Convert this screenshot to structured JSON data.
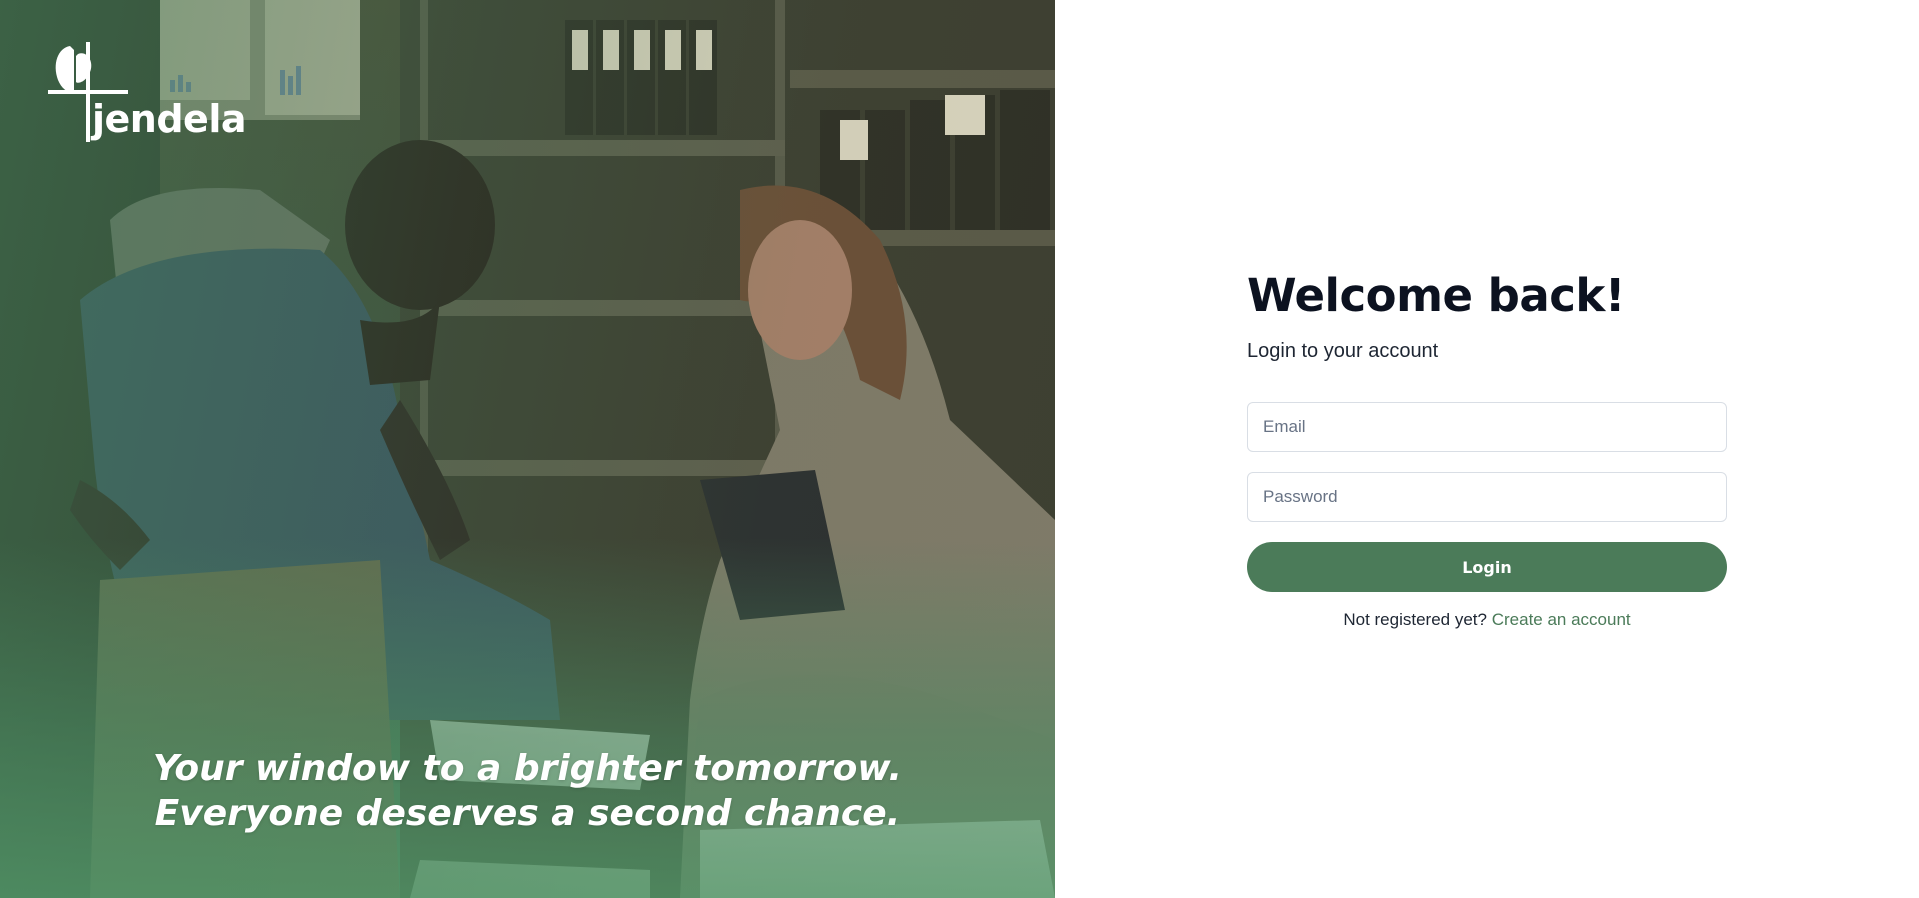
{
  "brand": {
    "name": "jendela",
    "tagline": "Your window to a brighter tomorrow. Everyone deserves a second chance.",
    "accent_color": "#4b7b59"
  },
  "login": {
    "title": "Welcome back!",
    "subtitle": "Login to your account",
    "email_placeholder": "Email",
    "password_placeholder": "Password",
    "submit_label": "Login",
    "signup_prompt": "Not registered yet?",
    "signup_link": "Create an account"
  },
  "icons": {
    "logo": "butterfly-window-logo"
  }
}
